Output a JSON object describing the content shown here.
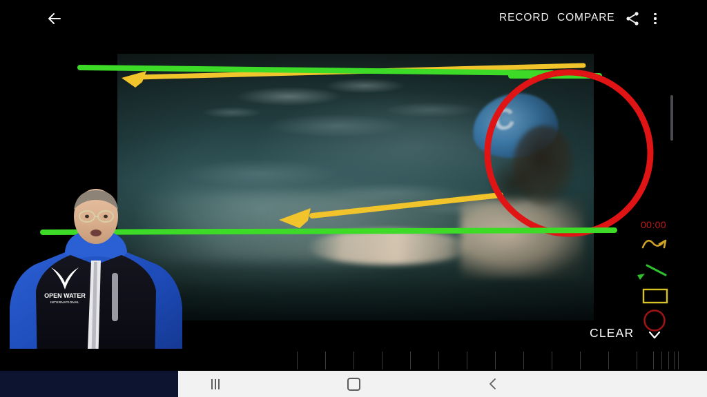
{
  "app": {
    "name": "video-analysis-app",
    "screen": "swim-stroke-analysis"
  },
  "topbar": {
    "back_label": "back-arrow",
    "record_label": "RECORD",
    "compare_label": "COMPARE",
    "share_label": "share-icon",
    "more_label": "more-options-icon"
  },
  "video": {
    "description": "Underwater footage of a freestyle swimmer wearing a blue swim cap",
    "cap_letter": "C"
  },
  "tools": {
    "timer": "00:00",
    "timer_color": "#c01818",
    "freehand_arrow": {
      "name": "freehand-arrow-tool",
      "color": "#d1a426"
    },
    "line": {
      "name": "line-tool",
      "color": "#2fbf2f"
    },
    "rectangle": {
      "name": "rectangle-tool",
      "color": "#d6c423"
    },
    "circle": {
      "name": "circle-tool",
      "color": "#9e1414"
    },
    "clear_label": "CLEAR",
    "chevron_label": "chevron-down-icon"
  },
  "annotations": {
    "items": [
      {
        "type": "line",
        "name": "green-line-top",
        "color": "#3ddb28"
      },
      {
        "type": "line",
        "name": "green-line-upper-right",
        "color": "#3ddb28"
      },
      {
        "type": "line",
        "name": "green-line-bottom",
        "color": "#3ddb28"
      },
      {
        "type": "arrow",
        "name": "yellow-arrow-top",
        "color": "#f0c42a"
      },
      {
        "type": "arrow",
        "name": "yellow-arrow-middle",
        "color": "#f0c42a"
      },
      {
        "type": "circle",
        "name": "red-circle-head",
        "color": "#e01414"
      }
    ]
  },
  "presenter": {
    "logo_text": "OPEN WATER",
    "logo_subtext": "INTERNATIONAL"
  },
  "navbar": {
    "recents_label": "recent-apps-icon",
    "home_label": "home-icon",
    "back_label": "back-icon"
  }
}
